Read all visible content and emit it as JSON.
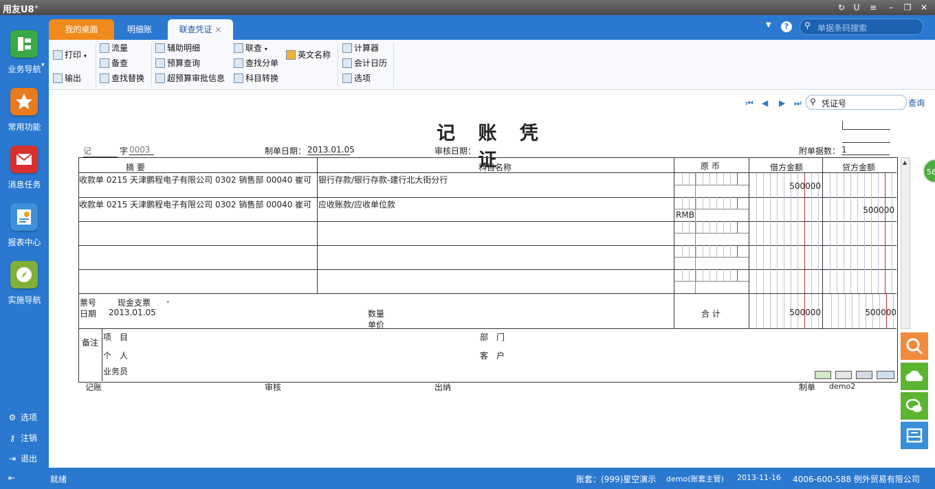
{
  "app": {
    "name": "用友U8",
    "sup": "+"
  },
  "left_nav": {
    "items": [
      {
        "label": "业务导航",
        "icon": "business-nav-icon",
        "color": "#3aa845"
      },
      {
        "label": "常用功能",
        "icon": "star-icon",
        "color": "#e97b1c"
      },
      {
        "label": "消息任务",
        "icon": "message-icon",
        "color": "#d8312c"
      },
      {
        "label": "报表中心",
        "icon": "report-icon",
        "color": "#3f8fd8"
      },
      {
        "label": "实施导航",
        "icon": "compass-icon",
        "color": "#7fb03a"
      }
    ],
    "bottom": [
      {
        "label": "选项",
        "icon": "gear-icon"
      },
      {
        "label": "注销",
        "icon": "key-icon"
      },
      {
        "label": "退出",
        "icon": "exit-icon"
      }
    ]
  },
  "tabs": [
    {
      "label": "我的桌面"
    },
    {
      "label": "明细账"
    },
    {
      "label": "联查凭证",
      "close": "×"
    }
  ],
  "search": {
    "placeholder": "单据条码搜索"
  },
  "toolbar": {
    "print": "打印",
    "export": "输出",
    "flow": "流量",
    "backup": "备查",
    "find_replace": "查找替换",
    "aux_detail": "辅助明细",
    "budget_query": "预算查询",
    "over_budget": "超预算审批信息",
    "link_query": "联查",
    "find_split": "查找分单",
    "subject_convert": "科目转换",
    "english_name": "英文名称",
    "calculator": "计算器",
    "calendar": "会计日历",
    "options": "选项"
  },
  "voucher_nav": {
    "field_label": "凭证号",
    "query": "查询"
  },
  "voucher": {
    "title": "记 账 凭 证",
    "type": "记",
    "zi": "字",
    "number": "0003",
    "date_label": "制单日期：",
    "date": "2013.01.05",
    "audit_date_label": "审核日期：",
    "attach_label": "附单据数：",
    "attach": "1",
    "headers": {
      "summary": "摘 要",
      "subject": "科目名称",
      "currency": "原 币",
      "debit": "借方金额",
      "credit": "贷方金额"
    },
    "rows": [
      {
        "summary": "收款单 0215 天津鹏程电子有限公司 0302 销售部 00040 崔可",
        "subject": "银行存款/银行存款-建行北大街分行",
        "currency": "",
        "debit": "500000",
        "credit": ""
      },
      {
        "summary": "收款单 0215 天津鹏程电子有限公司 0302 销售部 00040 崔可",
        "subject": "应收账款/应收单位款",
        "currency": "RMB",
        "debit": "",
        "credit": "500000"
      },
      {
        "summary": "",
        "subject": "",
        "currency": "",
        "debit": "",
        "credit": ""
      },
      {
        "summary": "",
        "subject": "",
        "currency": "",
        "debit": "",
        "credit": ""
      },
      {
        "summary": "",
        "subject": "",
        "currency": "",
        "debit": "",
        "credit": ""
      }
    ],
    "footer": {
      "ticket_label": "票号",
      "ticket_value": "现金支票",
      "ticket_dash": "-",
      "date_label": "日期",
      "date_value": "2013.01.05",
      "qty_label": "数量",
      "price_label": "单价",
      "total_label": "合 计",
      "total_debit": "500000",
      "total_credit": "500000"
    },
    "remarks": {
      "label": "备注",
      "project": "项　目",
      "dept": "部　门",
      "person": "个　人",
      "customer": "客　户",
      "salesman": "业务员"
    },
    "signatures": {
      "bookkeep": "记账",
      "audit": "审核",
      "cashier": "出纳",
      "maker": "制单",
      "maker_name": "demo2"
    }
  },
  "status": {
    "ready": "就绪",
    "account": "账套：(999)星空演示",
    "user": "demo(账套主管)",
    "date": "2013-11-16",
    "company": "4006-600-588 例外贸易有限公司"
  },
  "side_badge": "58",
  "colors": {
    "brand_blue": "#2a78cf",
    "tab_orange": "#f08a1c",
    "side_orange": "#f08a3c",
    "side_green": "#5cb531",
    "side_blue": "#3a8fd9",
    "amount_red": "#c43030"
  }
}
